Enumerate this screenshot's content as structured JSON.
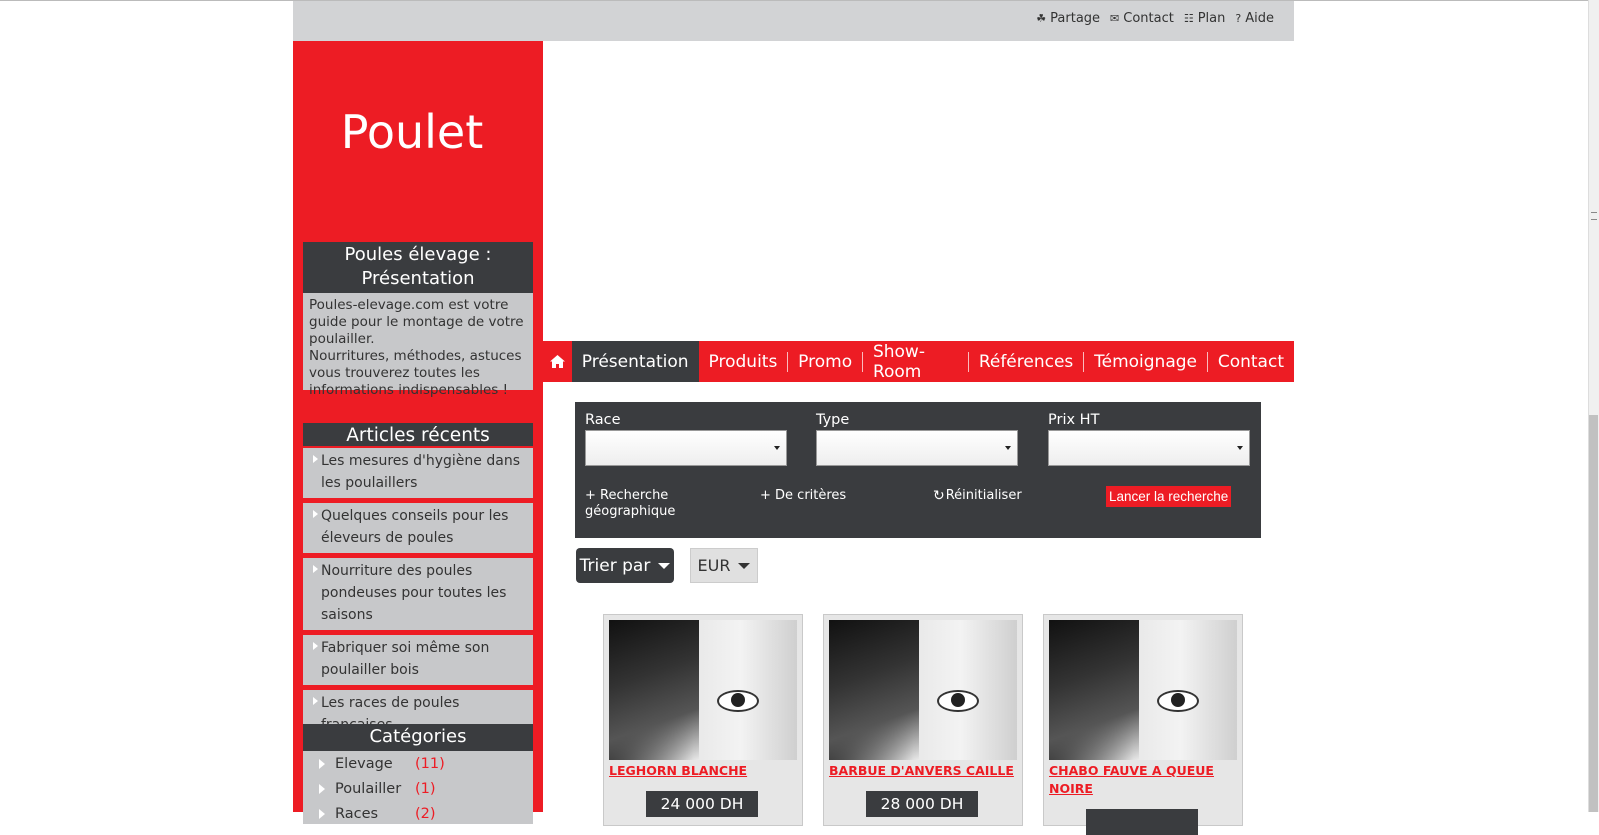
{
  "toplinks": [
    {
      "icon": "share-icon",
      "label": "Partage"
    },
    {
      "icon": "envelope-icon",
      "label": "Contact"
    },
    {
      "icon": "sitemap-icon",
      "label": "Plan"
    },
    {
      "icon": "question-icon",
      "label": "Aide"
    }
  ],
  "brand": "Poulet",
  "presentation": {
    "title": "Poules élevage : Présentation",
    "text1": "Poules-elevage.com est votre guide pour le montage de votre poulailler.",
    "text2": "Nourritures, méthodes, astuces vous trouverez toutes les informations indispensables !"
  },
  "articles": {
    "title": "Articles récents",
    "items": [
      "Les mesures d'hygiène dans les poulaillers",
      "Quelques conseils pour les éleveurs de poules",
      "Nourriture des poules pondeuses pour toutes les saisons",
      "Fabriquer soi même son poulailler bois",
      "Les races de poules françaises"
    ]
  },
  "categories": {
    "title": "Catégories",
    "items": [
      {
        "name": "Elevage",
        "count": "(11)"
      },
      {
        "name": "Poulailler",
        "count": "(1)"
      },
      {
        "name": "Races",
        "count": "(2)"
      }
    ]
  },
  "nav": {
    "items": [
      "Présentation",
      "Produits",
      "Promo",
      "Show-Room",
      "Références",
      "Témoignage",
      "Contact"
    ],
    "active": "Présentation"
  },
  "search": {
    "race_label": "Race",
    "type_label": "Type",
    "prix_label": "Prix HT",
    "geo": "+ Recherche géographique",
    "criteria": "+ De critères",
    "reset": "Réinitialiser",
    "submit": "Lancer la recherche"
  },
  "sort_label": "Trier par",
  "currency": "EUR",
  "products": [
    {
      "title": "LEGHORN BLANCHE",
      "price": "24 000 DH"
    },
    {
      "title": "BARBUE D'ANVERS CAILLE",
      "price": "28 000 DH"
    },
    {
      "title": "CHABO FAUVE A QUEUE NOIRE",
      "price": ""
    }
  ]
}
